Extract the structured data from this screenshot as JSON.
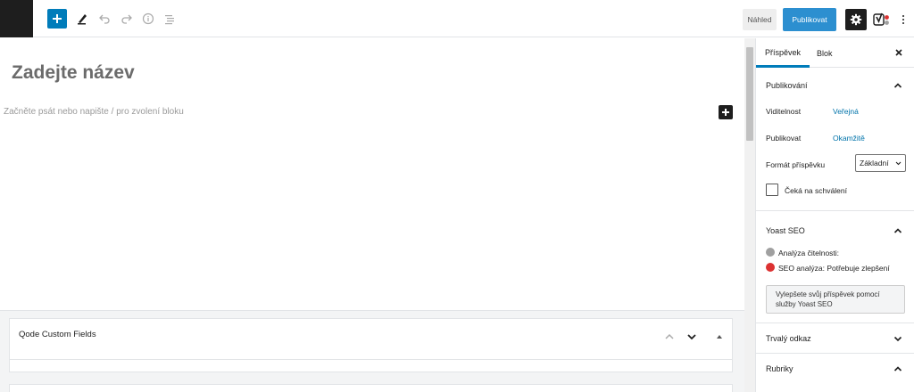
{
  "toolbar": {
    "preview_label": "Náhled",
    "publish_label": "Publikovat",
    "icons": [
      "add-block-icon",
      "edit-pencil-icon",
      "undo-icon",
      "redo-icon",
      "info-icon",
      "outline-list-icon",
      "gear-icon",
      "yoast-logo-icon",
      "more-vertical-icon"
    ]
  },
  "editor": {
    "title_placeholder": "Zadejte název",
    "body_placeholder": "Začněte psát nebo napište / pro zvolení bloku"
  },
  "metaboxes": {
    "qode_title": "Qode Custom Fields"
  },
  "sidebar": {
    "tabs": [
      {
        "label": "Příspěvek",
        "active": true
      },
      {
        "label": "Blok",
        "active": false
      }
    ],
    "publish_panel": {
      "title": "Publikování",
      "visibility_label": "Viditelnost",
      "visibility_value": "Veřejná",
      "publish_label": "Publikovat",
      "publish_value": "Okamžitě",
      "format_label": "Formát příspěvku",
      "format_value": "Základní",
      "pending_label": "Čeká na schválení"
    },
    "yoast_panel": {
      "title": "Yoast SEO",
      "readability": "Analýza čitelnosti:",
      "seo_analysis": "SEO analýza: Potřebuje zlepšení",
      "improve_button": "Vylepšete svůj příspěvek pomocí služby Yoast SEO"
    },
    "permalink_panel": {
      "title": "Trvalý odkaz"
    },
    "categories_panel": {
      "title": "Rubriky"
    }
  },
  "colors": {
    "accent": "#007cba",
    "link": "#0073aa",
    "readability_dot": "#a0a0a0",
    "seo_dot": "#dc3232"
  }
}
